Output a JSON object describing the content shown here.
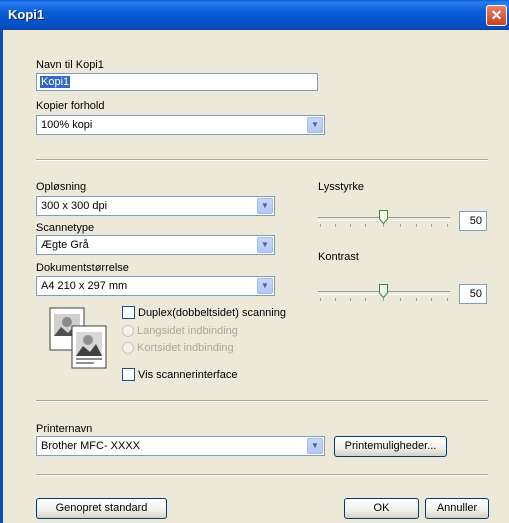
{
  "window": {
    "title": "Kopi1"
  },
  "name_field": {
    "label": "Navn til Kopi1",
    "value": "Kopi1"
  },
  "copy_ratio": {
    "label": "Kopier forhold",
    "value": "100% kopi"
  },
  "resolution": {
    "label": "Opløsning",
    "value": "300 x 300 dpi"
  },
  "scan_type": {
    "label": "Scannetype",
    "value": "Ægte Grå"
  },
  "document_size": {
    "label": "Dokumentstørrelse",
    "value": "A4 210 x 297 mm"
  },
  "duplex": {
    "label": "Duplex(dobbeltsidet) scanning",
    "checked": false
  },
  "binding": {
    "long_edge": "Langsidet indbinding",
    "short_edge": "Kortsidet indbinding"
  },
  "show_interface": {
    "label": "Vis scannerinterface",
    "checked": false
  },
  "brightness": {
    "label": "Lysstyrke",
    "value": "50",
    "level": 0.5
  },
  "contrast": {
    "label": "Kontrast",
    "value": "50",
    "level": 0.5
  },
  "printer": {
    "label": "Printernavn",
    "value": "Brother MFC- XXXX",
    "options_button": "Printemuligheder..."
  },
  "footer": {
    "restore_button": "Genopret standard",
    "ok_button": "OK",
    "cancel_button": "Annuller"
  },
  "colors": {
    "titlebar": "#0a5cd8",
    "panel": "#ece9d8",
    "selection": "#316ac5"
  }
}
